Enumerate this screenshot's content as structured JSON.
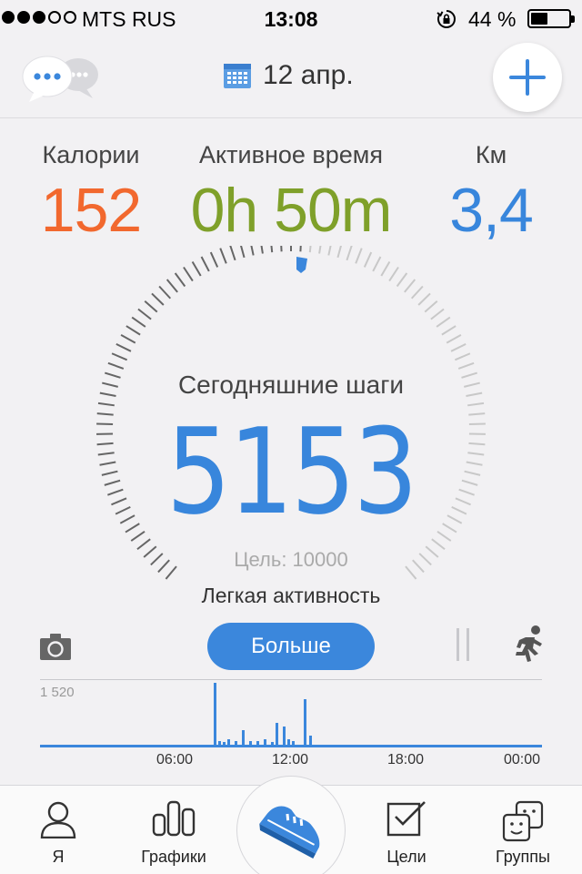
{
  "status_bar": {
    "carrier": "MTS RUS",
    "time": "13:08",
    "battery": "44 %",
    "battery_level": 0.44,
    "signal_bars_filled": 3,
    "signal_bars_total": 5
  },
  "header": {
    "date": "12 апр."
  },
  "stats": {
    "calories_label": "Калории",
    "calories_value": "152",
    "active_time_label": "Активное время",
    "active_time_value": "0h 50m",
    "km_label": "Км",
    "km_value": "3,4"
  },
  "dial": {
    "title": "Сегодняшние шаги",
    "steps": "5153",
    "goal": "Цель: 10000",
    "activity": "Легкая активность",
    "progress": 0.5153
  },
  "toolbar": {
    "more_label": "Больше"
  },
  "mini_chart": {
    "ymax_label": "1 520",
    "x_ticks": [
      "06:00",
      "12:00",
      "18:00",
      "00:00"
    ]
  },
  "tabbar": {
    "items": [
      {
        "label": "Я"
      },
      {
        "label": "Графики"
      },
      {
        "label": ""
      },
      {
        "label": "Цели"
      },
      {
        "label": "Группы"
      }
    ]
  },
  "colors": {
    "calories": "#f2682e",
    "active_time": "#7fa02a",
    "km": "#3886dc",
    "accent": "#3b87dc",
    "tick_active": "#666666",
    "tick_inactive": "#c8c8c8"
  },
  "icons": {
    "header_left": "chat-bubbles-icon",
    "date": "calendar-icon",
    "header_right": "plus-icon",
    "camera": "camera-icon",
    "pause": "pause-icon",
    "run": "running-man-icon",
    "tab_me": "person-icon",
    "tab_charts": "bar-chart-icon",
    "tab_center": "sneaker-icon",
    "tab_goals": "checkbox-icon",
    "tab_groups": "group-faces-icon"
  }
}
